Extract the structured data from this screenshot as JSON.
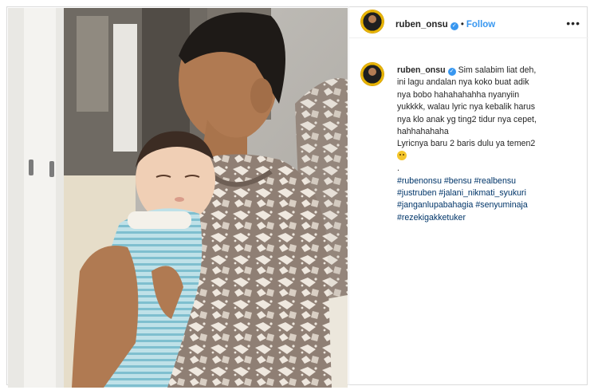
{
  "header": {
    "username": "ruben_onsu",
    "separator": "•",
    "follow_label": "Follow",
    "more_label": "•••",
    "avatar_icon": "avatar-icon",
    "verified_icon": "verified-badge-icon"
  },
  "comment": {
    "username": "ruben_onsu",
    "caption_lines": [
      "Sim salabim liat deh,",
      "ini lagu andalan nya koko buat adik",
      "nya bobo hahahahahha nyanyiin",
      "yukkkk, walau lyric nya kebalik harus",
      "nya klo anak yg ting2 tidur nya cepet,",
      "hahhahahaha",
      "Lyricnya baru 2 baris dulu ya temen2"
    ],
    "dot": ".",
    "hashtag_lines": [
      "#rubenonsu #bensu #realbensu",
      "#justruben #jalani_nikmati_syukuri",
      "#janganlupabahagia #senyuminaja",
      "#rezekigakketuker"
    ]
  },
  "colors": {
    "link": "#3897f0",
    "hashtag": "#003569",
    "text": "#262626",
    "border": "#dbdbdb"
  }
}
